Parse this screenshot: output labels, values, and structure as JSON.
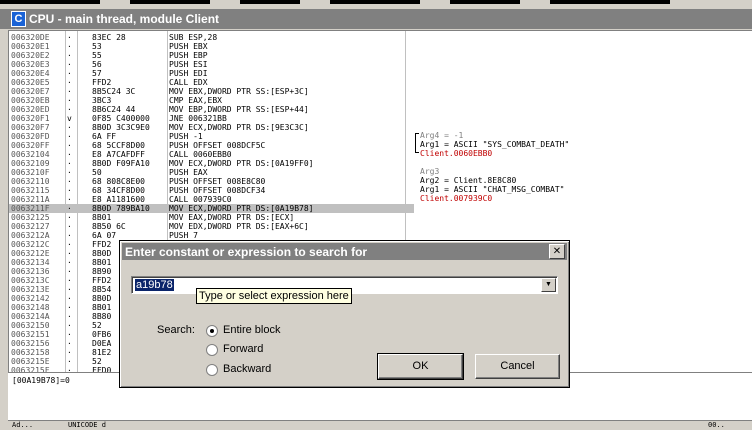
{
  "window": {
    "title": "CPU - main thread, module Client",
    "icon_letter": "C"
  },
  "disasm": {
    "rows": [
      {
        "addr": "006320DE",
        "mark": "·",
        "hex": "83EC 28",
        "dis": "SUB ESP,28"
      },
      {
        "addr": "006320E1",
        "mark": "·",
        "hex": "53",
        "dis": "PUSH EBX"
      },
      {
        "addr": "006320E2",
        "mark": "·",
        "hex": "55",
        "dis": "PUSH EBP"
      },
      {
        "addr": "006320E3",
        "mark": "·",
        "hex": "56",
        "dis": "PUSH ESI"
      },
      {
        "addr": "006320E4",
        "mark": "·",
        "hex": "57",
        "dis": "PUSH EDI"
      },
      {
        "addr": "006320E5",
        "mark": "·",
        "hex": "FFD2",
        "dis": "CALL EDX"
      },
      {
        "addr": "006320E7",
        "mark": "·",
        "hex": "8B5C24 3C",
        "dis": "MOV EBX,DWORD PTR SS:[ESP+3C]"
      },
      {
        "addr": "006320EB",
        "mark": "·",
        "hex": "3BC3",
        "dis": "CMP EAX,EBX"
      },
      {
        "addr": "006320ED",
        "mark": "·",
        "hex": "8B6C24 44",
        "dis": "MOV EBP,DWORD PTR SS:[ESP+44]"
      },
      {
        "addr": "006320F1",
        "mark": "v",
        "hex": "0F85 C400000",
        "dis": "JNE 006321BB"
      },
      {
        "addr": "006320F7",
        "mark": "·",
        "hex": "8B0D 3C3C9E0",
        "dis": "MOV ECX,DWORD PTR DS:[9E3C3C]"
      },
      {
        "addr": "006320FD",
        "mark": "·",
        "hex": "6A FF",
        "dis": "PUSH -1"
      },
      {
        "addr": "006320FF",
        "mark": "·",
        "hex": "68 5CCF8D00",
        "dis": "PUSH OFFSET 008DCF5C"
      },
      {
        "addr": "00632104",
        "mark": "·",
        "hex": "E8 A7CAFDFF",
        "dis": "CALL 0060EBB0"
      },
      {
        "addr": "00632109",
        "mark": "·",
        "hex": "8B0D F09FA10",
        "dis": "MOV ECX,DWORD PTR DS:[0A19FF0]"
      },
      {
        "addr": "0063210F",
        "mark": "·",
        "hex": "50",
        "dis": "PUSH EAX"
      },
      {
        "addr": "00632110",
        "mark": "·",
        "hex": "68 808C8E00",
        "dis": "PUSH OFFSET 008E8C80"
      },
      {
        "addr": "00632115",
        "mark": "·",
        "hex": "68 34CF8D00",
        "dis": "PUSH OFFSET 008DCF34"
      },
      {
        "addr": "0063211A",
        "mark": "·",
        "hex": "E8 A1181600",
        "dis": "CALL 007939C0"
      },
      {
        "addr": "0063211F",
        "mark": "·",
        "hex": "8B0D 789BA10",
        "dis": "MOV ECX,DWORD PTR DS:[0A19B78]"
      },
      {
        "addr": "00632125",
        "mark": "·",
        "hex": "8B01",
        "dis": "MOV EAX,DWORD PTR DS:[ECX]"
      },
      {
        "addr": "00632127",
        "mark": "·",
        "hex": "8B50 6C",
        "dis": "MOV EDX,DWORD PTR DS:[EAX+6C]"
      },
      {
        "addr": "0063212A",
        "mark": "·",
        "hex": "6A 07",
        "dis": "PUSH 7"
      },
      {
        "addr": "0063212C",
        "mark": "·",
        "hex": "FFD2",
        "dis": ""
      },
      {
        "addr": "0063212E",
        "mark": "·",
        "hex": "8B0D",
        "dis": ""
      },
      {
        "addr": "00632134",
        "mark": "·",
        "hex": "8B01",
        "dis": ""
      },
      {
        "addr": "00632136",
        "mark": "·",
        "hex": "8B90",
        "dis": ""
      },
      {
        "addr": "0063213C",
        "mark": "·",
        "hex": "FFD2",
        "dis": ""
      },
      {
        "addr": "0063213E",
        "mark": "·",
        "hex": "8B54",
        "dis": ""
      },
      {
        "addr": "00632142",
        "mark": "·",
        "hex": "8B0D",
        "dis": ""
      },
      {
        "addr": "00632148",
        "mark": "·",
        "hex": "8B01",
        "dis": ""
      },
      {
        "addr": "0063214A",
        "mark": "·",
        "hex": "8B80",
        "dis": ""
      },
      {
        "addr": "00632150",
        "mark": "·",
        "hex": "52",
        "dis": ""
      },
      {
        "addr": "00632151",
        "mark": "·",
        "hex": "0FB6",
        "dis": ""
      },
      {
        "addr": "00632156",
        "mark": "·",
        "hex": "D0EA",
        "dis": ""
      },
      {
        "addr": "00632158",
        "mark": "·",
        "hex": "81E2",
        "dis": ""
      },
      {
        "addr": "0063215E",
        "mark": "·",
        "hex": "52",
        "dis": ""
      },
      {
        "addr": "0063215F",
        "mark": "·",
        "hex": "FFD0",
        "dis": ""
      }
    ]
  },
  "comments": {
    "c1": "Arg4 = -1",
    "c2": "Arg1 = ASCII \"SYS_COMBAT_DEATH\"",
    "c3": "Client.0060EBB0",
    "c4": "Arg3",
    "c5": "Arg2 = Client.8E8C80",
    "c6": "Arg1 = ASCII \"CHAT_MSG_COMBAT\"",
    "c7": "Client.007939C0"
  },
  "status_line": "[00A19B78]=0",
  "bottom": {
    "left": "Ad...",
    "mid": "UNICODE d",
    "right": "00.."
  },
  "dialog": {
    "title": "Enter constant or expression to search for",
    "close_glyph": "✕",
    "input_value": "a19b78",
    "tooltip": "Type or select expression here",
    "dropdown_glyph": "▼",
    "search_label": "Search:",
    "options": {
      "entire": "Entire block",
      "forward": "Forward",
      "backward": "Backward"
    },
    "selected_option": "entire",
    "ok_label": "OK",
    "cancel_label": "Cancel"
  }
}
